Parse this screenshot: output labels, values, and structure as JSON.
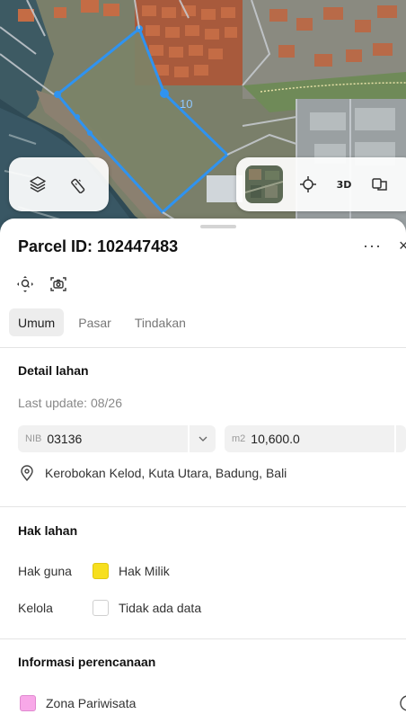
{
  "map": {
    "parcel_edge_label": "10",
    "controls_left": [
      {
        "name": "layers-icon"
      },
      {
        "name": "measure-icon"
      }
    ],
    "controls_right": {
      "basemap": "satellite-thumbnail",
      "locate_icon": "crosshair-icon",
      "three_d_label": "3D",
      "compare_icon": "compare-icon"
    },
    "parcel_color": "#2f93f0"
  },
  "sheet": {
    "title": "Parcel ID: 102447483",
    "more_label": "···",
    "close_label": "×",
    "tabs": [
      {
        "label": "Umum",
        "active": true
      },
      {
        "label": "Pasar",
        "active": false
      },
      {
        "label": "Tindakan",
        "active": false
      }
    ],
    "detail": {
      "heading": "Detail lahan",
      "last_update": "Last update: 08/26",
      "nib_prefix": "NIB",
      "nib_value": "03136",
      "area_prefix": "m2",
      "area_value": "10,600.0",
      "address": "Kerobokan Kelod, Kuta Utara, Badung, Bali"
    },
    "rights": {
      "heading": "Hak lahan",
      "rows": [
        {
          "label": "Hak guna",
          "value": "Hak Milik",
          "color": "#f7df1e"
        },
        {
          "label": "Kelola",
          "value": "Tidak ada data",
          "color": "#ffffff"
        }
      ]
    },
    "planning": {
      "heading": "Informasi perencanaan",
      "zone": "Zona Pariwisata",
      "zone_color": "#f8a8e8"
    }
  }
}
